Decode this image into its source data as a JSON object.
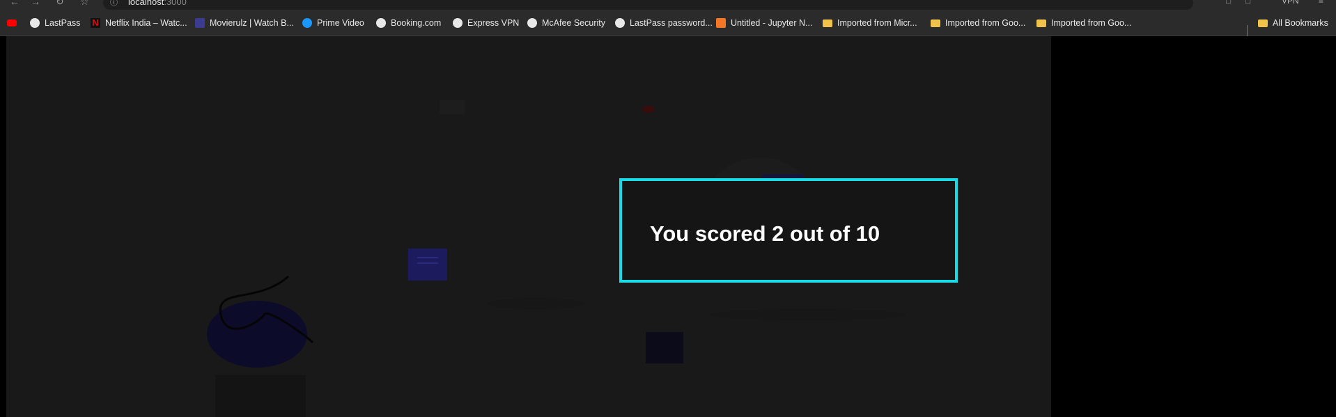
{
  "browser": {
    "url_host": "localhost",
    "url_port": ":3000",
    "vpn_label": "VPN"
  },
  "bookmarks": [
    {
      "label": "",
      "icon": "youtube-icon"
    },
    {
      "label": "LastPass",
      "icon": "globe-icon"
    },
    {
      "label": "Netflix India – Watc...",
      "icon": "netflix-icon"
    },
    {
      "label": "Movierulz | Watch B...",
      "icon": "movierulz-icon"
    },
    {
      "label": "Prime Video",
      "icon": "prime-video-icon"
    },
    {
      "label": "Booking.com",
      "icon": "globe-icon"
    },
    {
      "label": "Express VPN",
      "icon": "globe-icon"
    },
    {
      "label": "McAfee Security",
      "icon": "globe-icon"
    },
    {
      "label": "LastPass password...",
      "icon": "globe-icon"
    },
    {
      "label": "Untitled - Jupyter N...",
      "icon": "jupyter-icon"
    },
    {
      "label": "Imported from Micr...",
      "icon": "folder-icon"
    },
    {
      "label": "Imported from Goo...",
      "icon": "folder-icon"
    },
    {
      "label": "Imported from Goo...",
      "icon": "folder-icon"
    }
  ],
  "all_bookmarks": {
    "label": "All Bookmarks",
    "icon": "folder-icon"
  },
  "result": {
    "score_text": "You scored 2 out of 10",
    "border_color": "#17dbe6"
  }
}
